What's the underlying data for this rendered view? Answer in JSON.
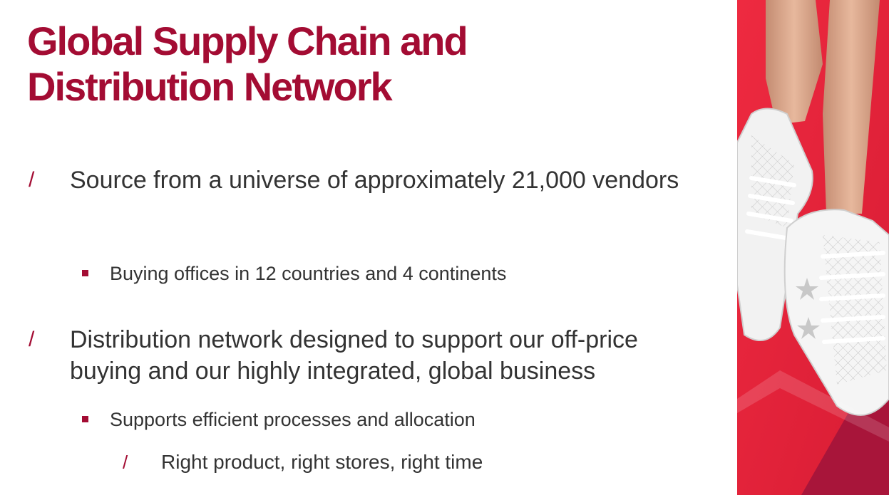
{
  "slide": {
    "title_line1": "Global Supply Chain and",
    "title_line2": "Distribution Network",
    "bullets": [
      {
        "marker": "/",
        "text": "Source from a universe of approximately 21,000 vendors",
        "sub": [
          {
            "text": "Buying offices in 12 countries and 4 continents"
          }
        ]
      },
      {
        "marker": "/",
        "text": "Distribution network designed to support our off-price buying and our highly integrated, global business",
        "sub": [
          {
            "text": "Supports efficient processes and allocation",
            "sub": [
              {
                "marker": "/",
                "text": "Right product, right stores, right time"
              }
            ]
          }
        ]
      }
    ]
  },
  "photo": {
    "icon": "sneakers-photo",
    "colors": {
      "background": "#e8203a",
      "accent_triangle": "#a8153a"
    }
  },
  "colors": {
    "title": "#a30c33",
    "body_text": "#333333",
    "bullet_marker": "#a30c33"
  }
}
